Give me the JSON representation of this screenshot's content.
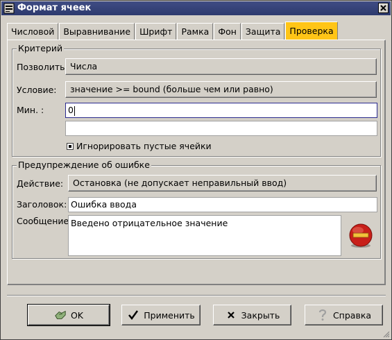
{
  "window": {
    "title": "Формат ячеек"
  },
  "tabs": [
    {
      "label": "Числовой",
      "active": false
    },
    {
      "label": "Выравнивание",
      "active": false
    },
    {
      "label": "Шрифт",
      "active": false
    },
    {
      "label": "Рамка",
      "active": false
    },
    {
      "label": "Фон",
      "active": false
    },
    {
      "label": "Защита",
      "active": false
    },
    {
      "label": "Проверка",
      "active": true
    }
  ],
  "criteria": {
    "group_title": "Критерий",
    "allow_label": "Позволить:",
    "allow_value": "Числа",
    "condition_label": "Условие:",
    "condition_value": "значение >= bound  (больше чем или равно)",
    "min_label": "Мин. :",
    "min_value": "0",
    "second_value": "",
    "ignore_blank_label": "Игнорировать пустые ячейки",
    "ignore_blank_checked": true
  },
  "error_alert": {
    "group_title": "Предупреждение об ошибке",
    "action_label": "Действие:",
    "action_value": "Остановка (не допускает неправильный ввод)",
    "title_label": "Заголовок:",
    "title_value": "Ошибка ввода",
    "message_label": "Сообщение:",
    "message_value": "Введено отрицательное значение",
    "icon": "stop-error-icon"
  },
  "buttons": {
    "ok": "OK",
    "apply": "Применить",
    "close": "Закрыть",
    "help": "Справка"
  },
  "colors": {
    "active_tab": "#ffc517",
    "titlebar": "#35427a",
    "error_icon": "#c8201a"
  }
}
